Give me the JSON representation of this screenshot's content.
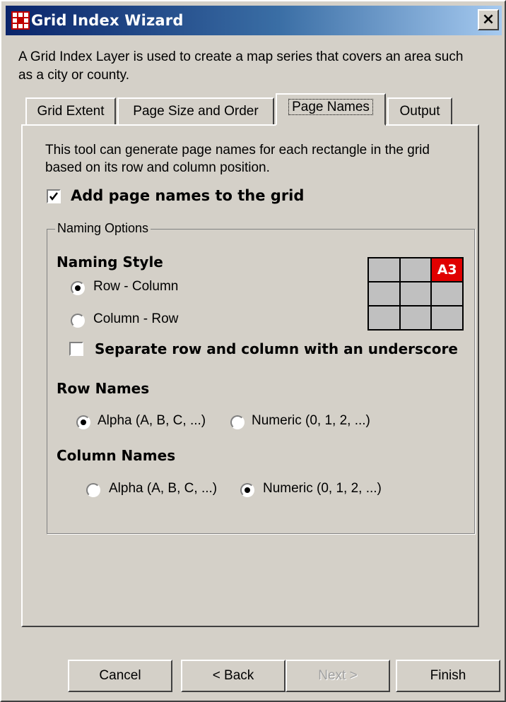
{
  "window": {
    "title": "Grid Index Wizard",
    "close_label": "×",
    "intro": "A Grid Index Layer is used to create a map series that covers an area such as a city or county."
  },
  "tabs": [
    {
      "label": "Grid Extent",
      "active": false
    },
    {
      "label": "Page Size and Order",
      "active": false
    },
    {
      "label": "Page Names",
      "active": true
    },
    {
      "label": "Output",
      "active": false
    }
  ],
  "page_names": {
    "description": "This tool can generate page names for each rectangle in the grid based on its row and column position.",
    "add_names_label": "Add page names to the grid",
    "add_names_checked": true,
    "naming_options": {
      "group_label": "Naming Options",
      "style_heading": "Naming Style",
      "style_row_column": "Row - Column",
      "style_column_row": "Column - Row",
      "selected_style": "Row - Column",
      "underscore_label": "Separate row and column with an underscore",
      "underscore_checked": false,
      "preview_label": "A3",
      "row_names_heading": "Row Names",
      "row_alpha": "Alpha (A, B, C, ...)",
      "row_numeric": "Numeric (0, 1, 2, ...)",
      "row_selected": "alpha",
      "column_names_heading": "Column Names",
      "col_alpha": "Alpha (A, B, C, ...)",
      "col_numeric": "Numeric (0, 1, 2, ...)",
      "col_selected": "numeric"
    }
  },
  "buttons": {
    "cancel": "Cancel",
    "back": "< Back",
    "next": "Next >",
    "finish": "Finish"
  },
  "colors": {
    "titlebar_start": "#0a246a",
    "titlebar_end": "#a6caf0",
    "preview_highlight": "#e00000",
    "face": "#d4d0c8"
  }
}
